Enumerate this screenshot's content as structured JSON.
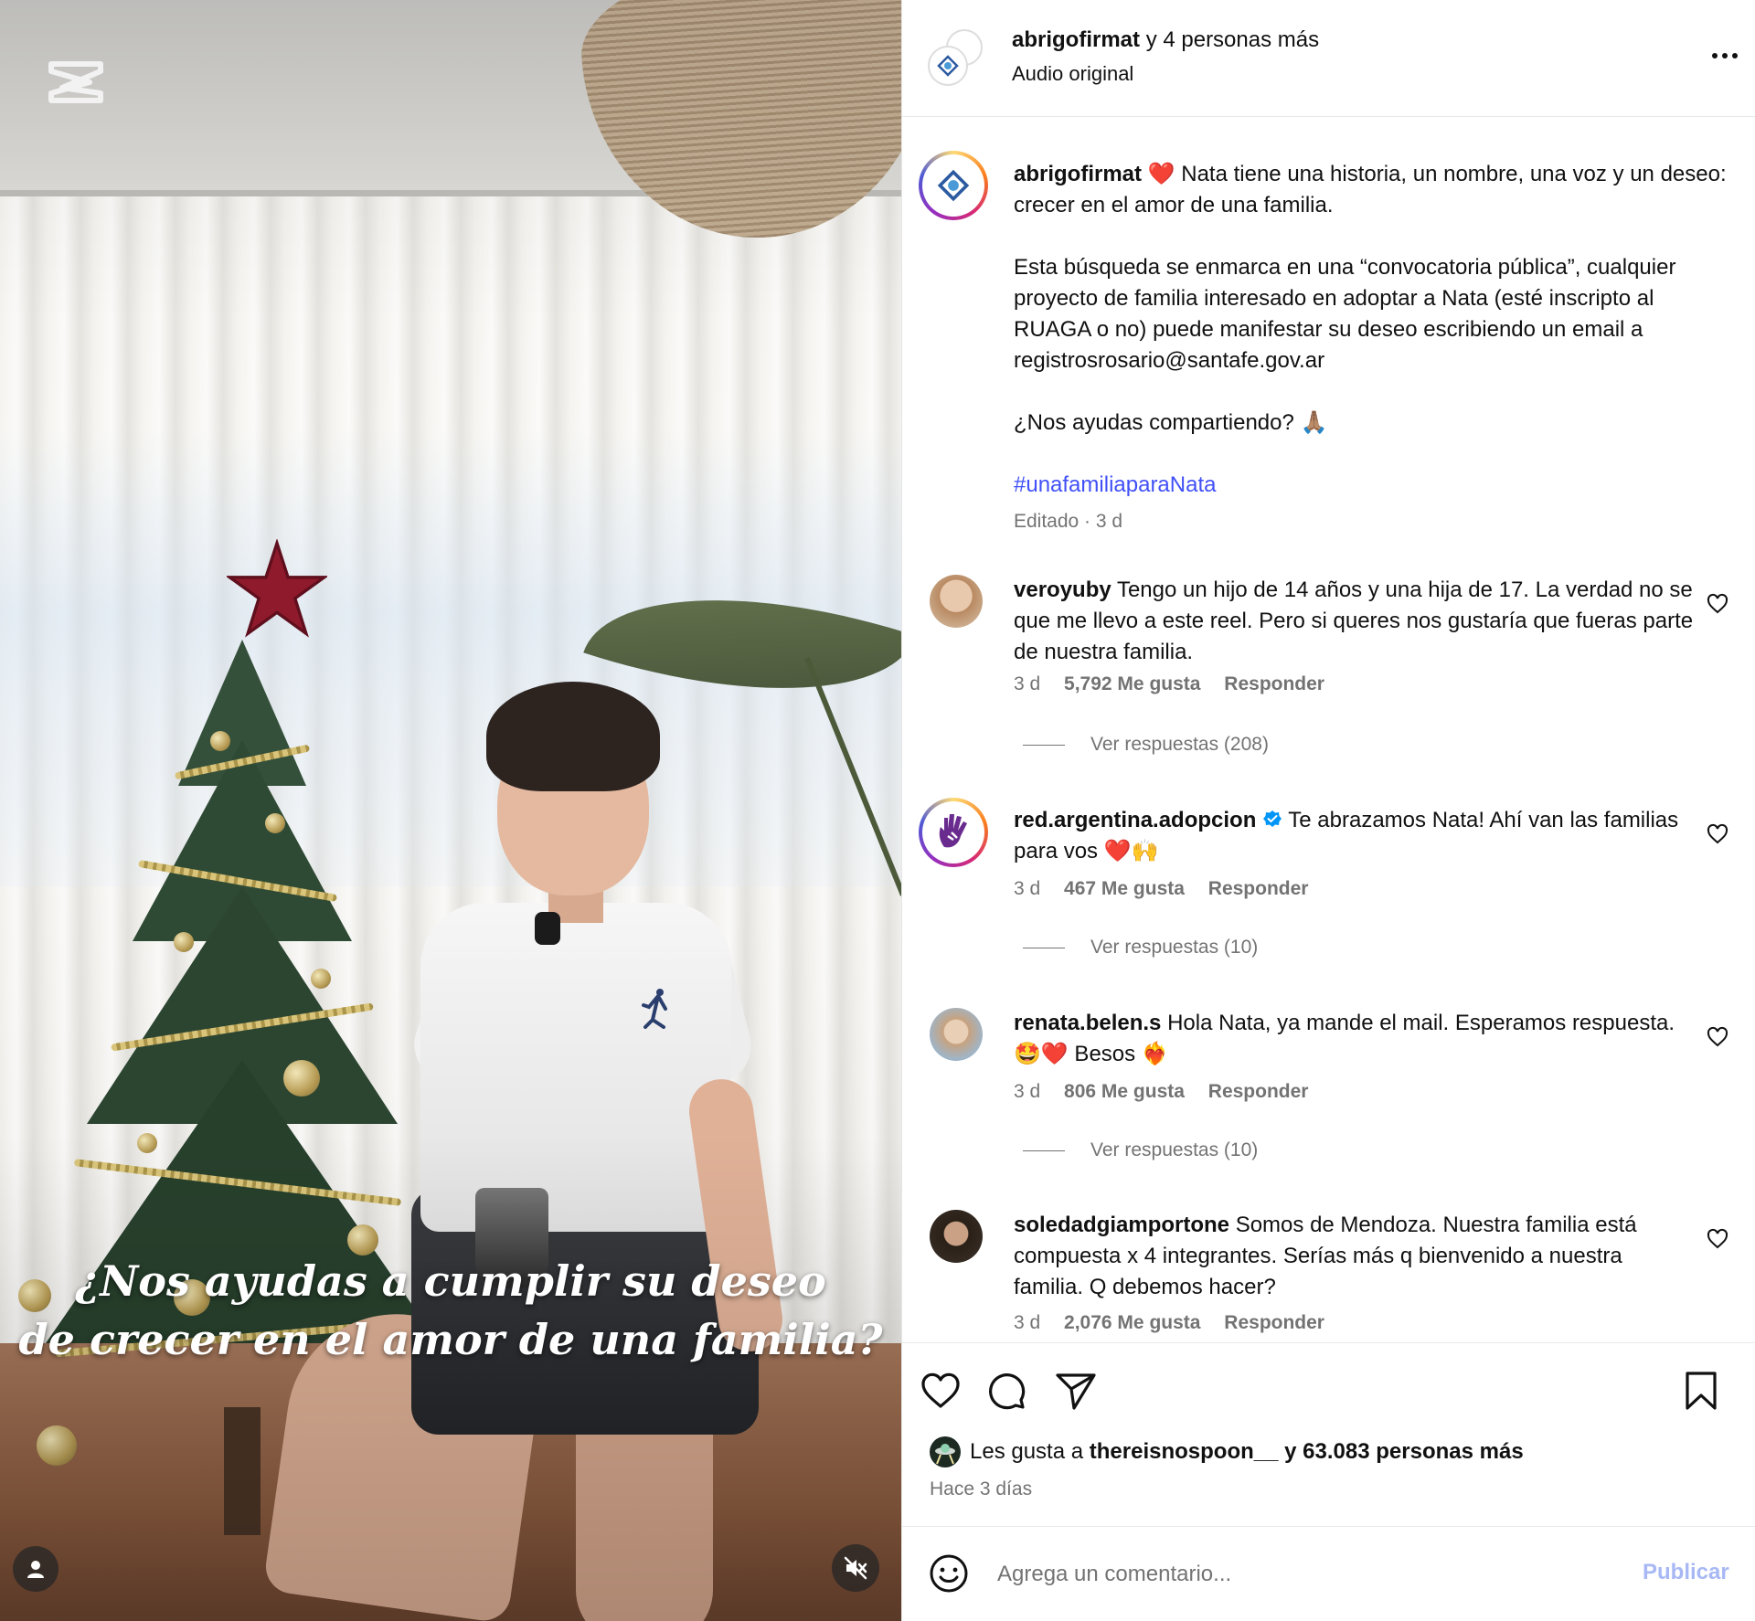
{
  "video": {
    "caption_line1": "¿Nos ayudas a cumplir su deseo",
    "caption_line2": "de crecer en el amor de una familia?",
    "capcut_icon": "capcut-logo-icon",
    "user_icon": "user-icon",
    "mute_icon": "muted-speaker-icon"
  },
  "header": {
    "username": "abrigofirmat",
    "coauthors": "y 4 personas más",
    "audio": "Audio original",
    "more_icon": "more-options-icon"
  },
  "post": {
    "username": "abrigofirmat",
    "heart_emoji": "❤️",
    "text1": "Nata tiene una historia, un nombre, una voz y un deseo: crecer en el amor de una familia.",
    "text2": "Esta búsqueda se enmarca en una “convocatoria pública”, cualquier proyecto de familia interesado en adoptar a Nata (esté inscripto al RUAGA o no) puede manifestar su deseo escribiendo un email a registrosrosario@santafe.gov.ar",
    "text3": "¿Nos ayudas compartiendo? 🙏🏽",
    "hashtag": "#unafamiliaparaNata",
    "meta": "Editado · 3 d"
  },
  "comments": [
    {
      "username": "veroyuby",
      "text": "Tengo un hijo de 14 años y una hija de 17. La verdad no se que me llevo a este reel. Pero si queres nos gustaría que fueras parte de nuestra familia.",
      "time": "3 d",
      "likes": "5,792 Me gusta",
      "reply": "Responder",
      "replies": "Ver respuestas (208)"
    },
    {
      "username": "red.argentina.adopcion",
      "verified": true,
      "text": "Te abrazamos Nata! Ahí van las familias para vos ❤️🙌",
      "time": "3 d",
      "likes": "467 Me gusta",
      "reply": "Responder",
      "replies": "Ver respuestas (10)"
    },
    {
      "username": "renata.belen.s",
      "text": "Hola Nata, ya mande el mail. Esperamos respuesta. 🤩❤️ Besos ❤️‍🔥",
      "time": "3 d",
      "likes": "806 Me gusta",
      "reply": "Responder",
      "replies": "Ver respuestas (10)"
    },
    {
      "username": "soledadgiamportone",
      "text": "Somos de Mendoza. Nuestra familia está compuesta x 4 integrantes. Serías más q bienvenido a nuestra familia. Q debemos hacer?",
      "time": "3 d",
      "likes": "2,076 Me gusta",
      "reply": "Responder"
    }
  ],
  "actions": {
    "like_icon": "heart-icon",
    "comment_icon": "comment-icon",
    "share_icon": "send-icon",
    "save_icon": "bookmark-icon",
    "likes_prefix": "Les gusta a",
    "likes_user": "thereisnospoon__",
    "likes_suffix": "y 63.083 personas más",
    "time_ago": "Hace 3 días"
  },
  "composer": {
    "emoji_icon": "emoji-icon",
    "placeholder": "Agrega un comentario...",
    "publish": "Publicar"
  },
  "colors": {
    "link": "#4150f7",
    "muted_text": "#737373",
    "publish_disabled": "#a7b8f5",
    "verified": "#0095f6",
    "heart": "#e0245e"
  }
}
